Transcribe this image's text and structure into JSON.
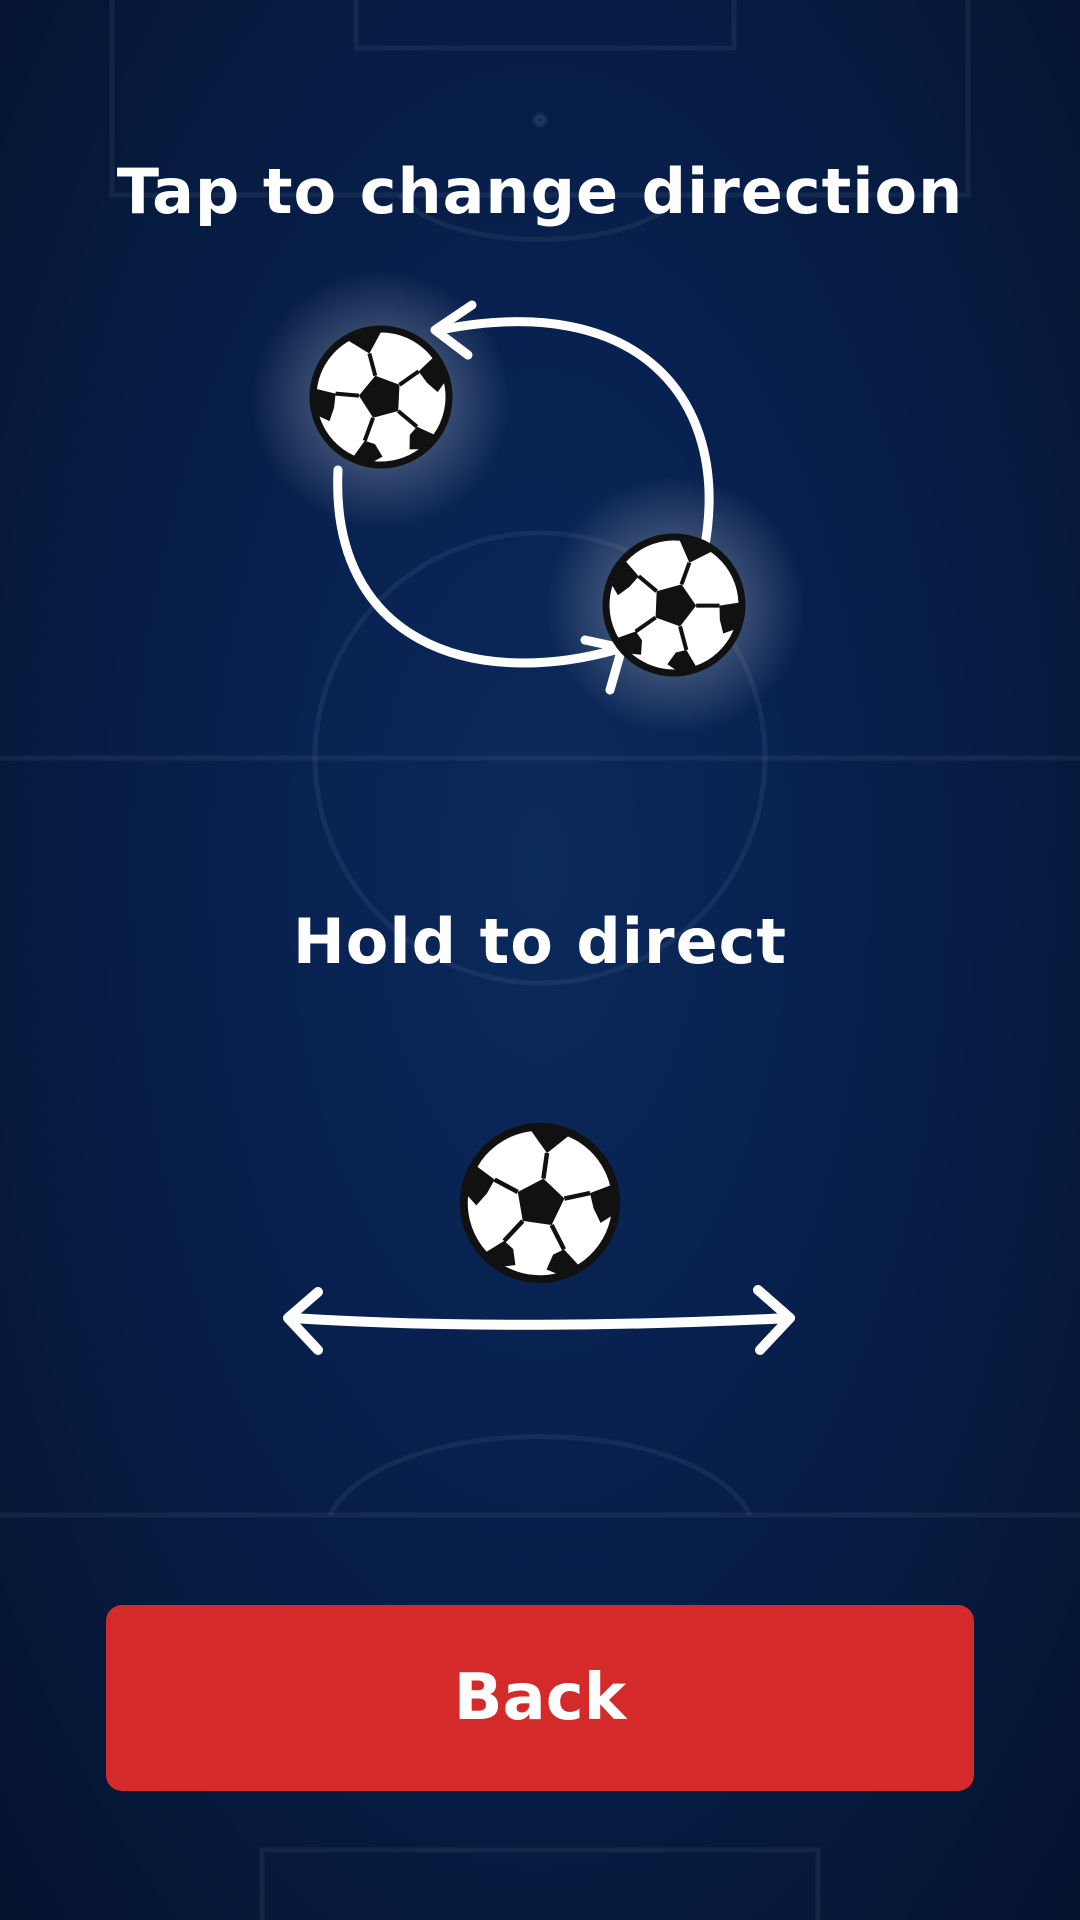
{
  "instructions": {
    "tap_text": "Tap to change direction",
    "hold_text": "Hold to direct"
  },
  "buttons": {
    "back_label": "Back"
  },
  "icons": {
    "ball": "soccer-ball-icon",
    "circular_arrows": "circular-arrows-icon",
    "horizontal_arrow": "double-headed-arrow-icon"
  },
  "colors": {
    "background": "#061a3e",
    "button": "#d42a2a",
    "text": "#ffffff"
  }
}
